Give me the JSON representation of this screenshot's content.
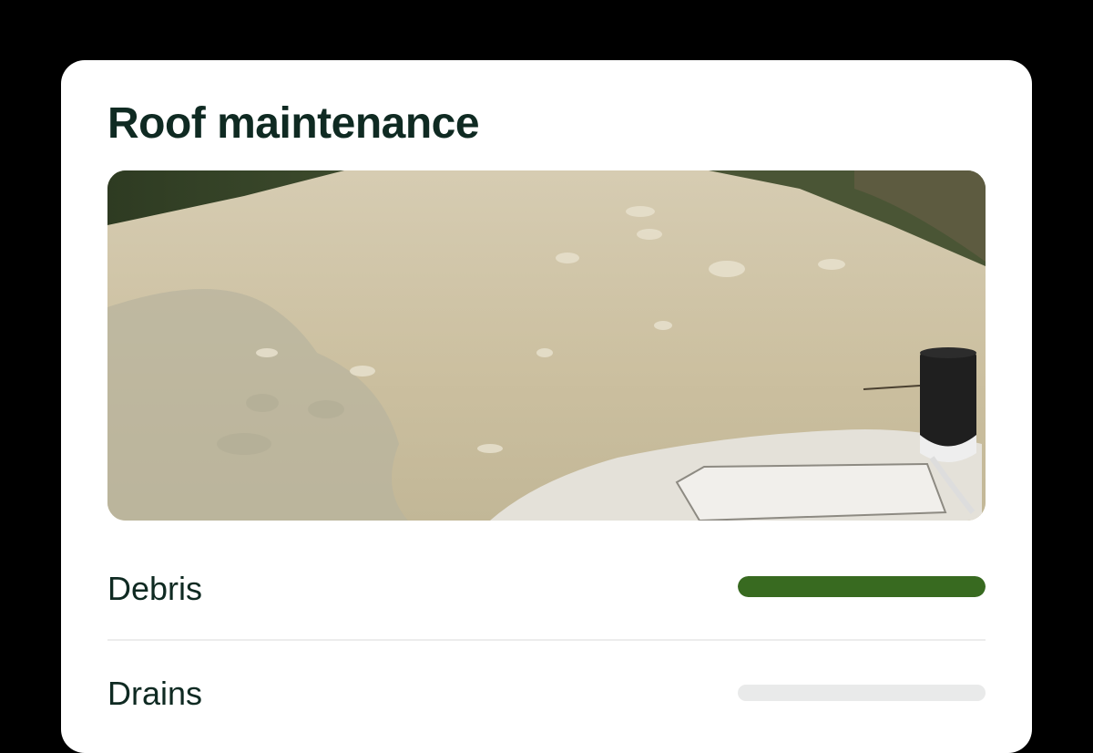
{
  "card": {
    "title": "Roof maintenance"
  },
  "photo": {
    "subject": "roof-photo"
  },
  "checklist": [
    {
      "label": "Debris",
      "progress": 1.0,
      "color": "#386a20"
    },
    {
      "label": "Drains",
      "progress": 0.0,
      "color": "#386a20"
    }
  ],
  "colors": {
    "title": "#0f2a22",
    "accent": "#386a20",
    "track": "#e9eaea"
  }
}
